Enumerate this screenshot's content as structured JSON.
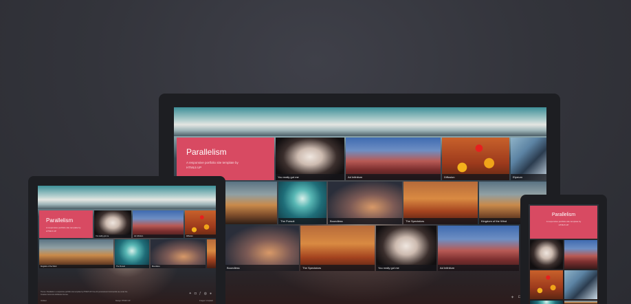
{
  "brand": {
    "title": "Parallelism",
    "description": "A responsive portfolio site template by HTML5 UP"
  },
  "captions": {
    "you_really": "You really got me",
    "ad_infinitum": "Ad Infinitum",
    "diffusion": "Diffusion",
    "elysium": "Elysium",
    "pursuit": "The Pursuit",
    "boundless": "Boundless",
    "spectators": "The Spectators",
    "kingdom": "Kingdom of the Wind",
    "tiny_left": "Ad Infinitum"
  },
  "tablet_footer": {
    "credit": "Theme: Parallelism: a responsive portfolio site template by HTML5 UP. Free for personal and commercial use under the Creative Commons Attribution license.",
    "left_small": "Untitled",
    "mid_small": "Design: HTML5 UP",
    "right_small": "Images: Unsplash"
  },
  "colors": {
    "accent": "#d84a62",
    "bezel": "#1d1e22",
    "background": "#33343b"
  },
  "icons": [
    "twitter-icon",
    "instagram-icon",
    "facebook-icon",
    "dribbble-icon",
    "github-icon"
  ]
}
